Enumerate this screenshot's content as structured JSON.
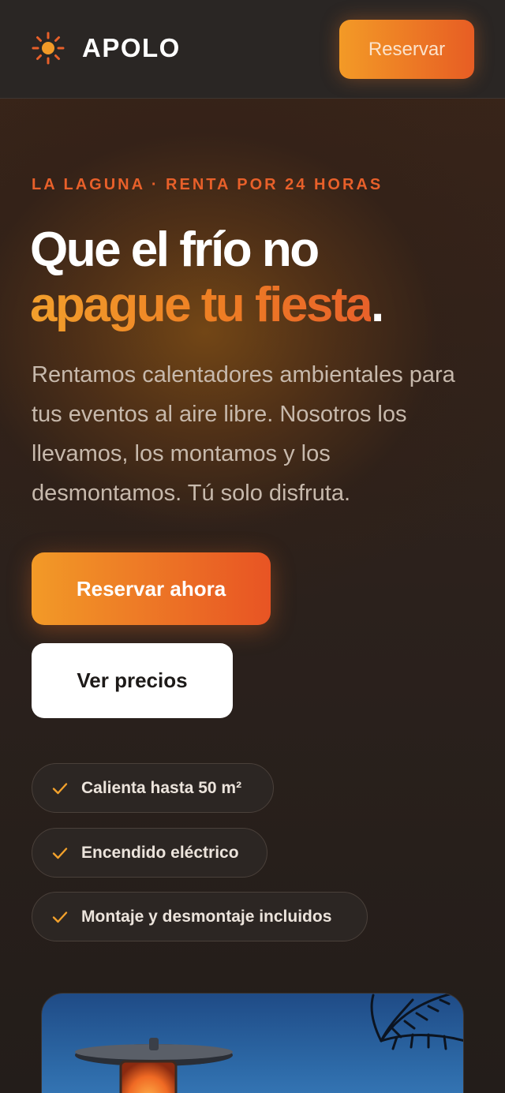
{
  "brand": {
    "name": "APOLO",
    "icon": "sun-icon",
    "accent_color": "#ef7a27"
  },
  "header": {
    "cta_label": "Reservar"
  },
  "hero": {
    "eyebrow": "LA LAGUNA · RENTA POR 24 HORAS",
    "headline_line1": "Que el frío no",
    "headline_accent": "apague tu fiesta",
    "headline_period": ".",
    "subtitle": "Rentamos calentadores ambientales para tus eventos al aire libre. Nosotros los llevamos, los montamos y los desmontamos. Tú solo disfruta.",
    "primary_cta": "Reservar ahora",
    "secondary_cta": "Ver precios"
  },
  "features": [
    {
      "icon": "check-icon",
      "label": "Calienta hasta 50 m²"
    },
    {
      "icon": "check-icon",
      "label": "Encendido eléctrico"
    },
    {
      "icon": "check-icon",
      "label": "Montaje y desmontaje incluidos"
    }
  ],
  "colors": {
    "orange_start": "#f29a27",
    "orange_end": "#e85424",
    "background": "#221c19",
    "eyebrow": "#e8602a"
  }
}
